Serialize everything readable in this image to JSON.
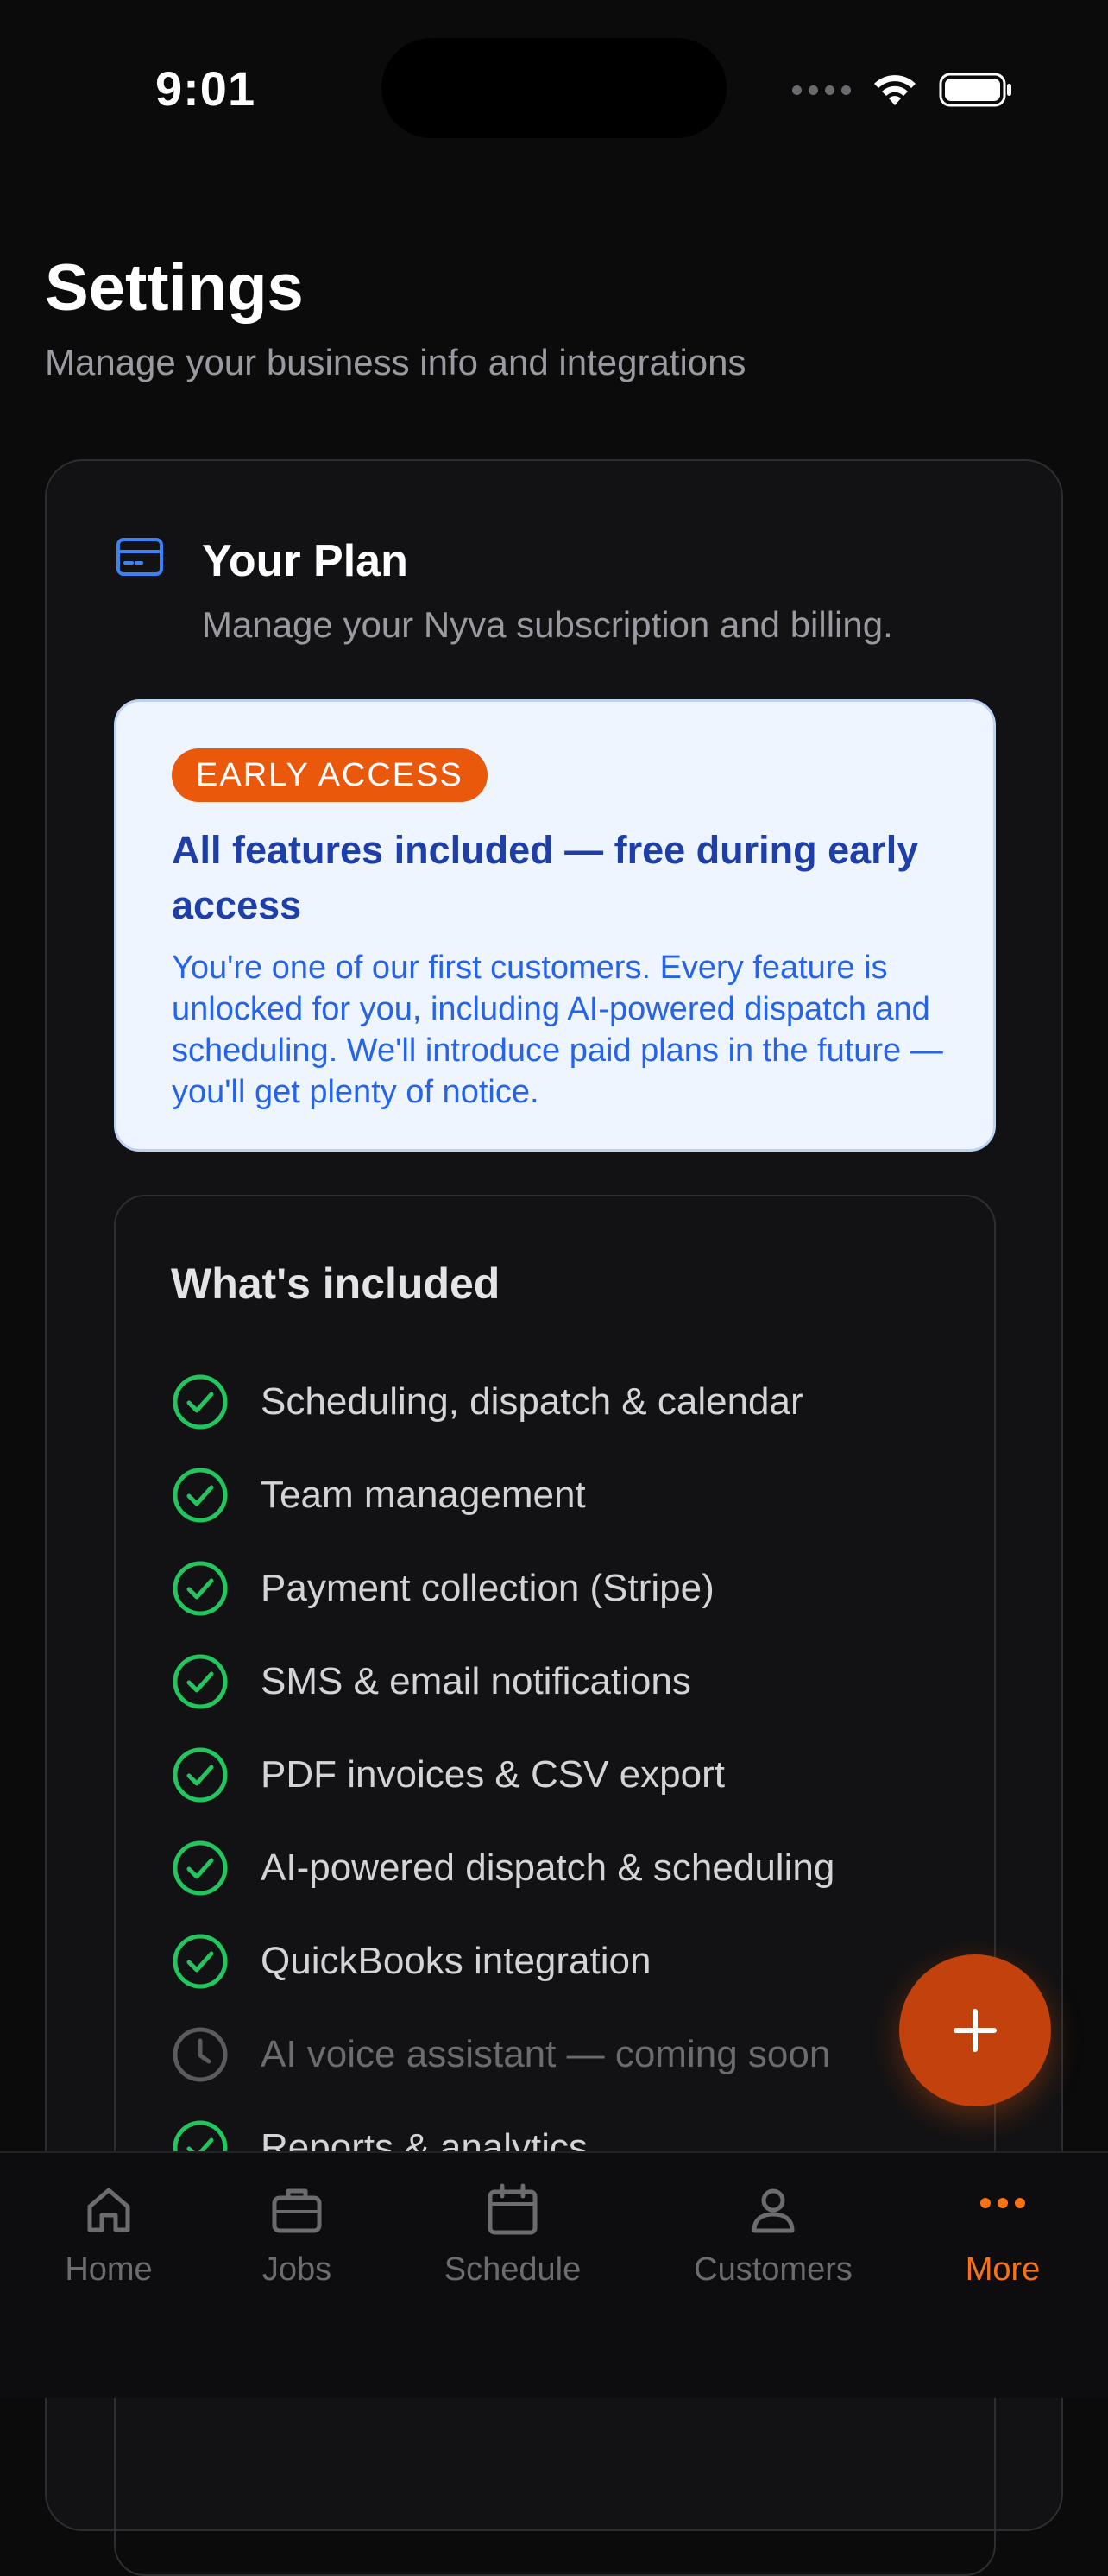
{
  "status_bar": {
    "time": "9:01"
  },
  "header": {
    "title": "Settings",
    "subtitle": "Manage your business info and integrations"
  },
  "plan": {
    "icon": "credit-card-icon",
    "title": "Your Plan",
    "description": "Manage your Nyva subscription and billing.",
    "early_access": {
      "badge": "EARLY ACCESS",
      "heading": "All features included — free during early access",
      "body": "You're one of our first customers. Every feature is unlocked for you, including AI-powered dispatch and scheduling. We'll introduce paid plans in the future — you'll get plenty of notice."
    },
    "included": {
      "title": "What's included",
      "features": [
        {
          "label": "Scheduling, dispatch & calendar",
          "status": "included"
        },
        {
          "label": "Team management",
          "status": "included"
        },
        {
          "label": "Payment collection (Stripe)",
          "status": "included"
        },
        {
          "label": "SMS & email notifications",
          "status": "included"
        },
        {
          "label": "PDF invoices & CSV export",
          "status": "included"
        },
        {
          "label": "AI-powered dispatch & scheduling",
          "status": "included"
        },
        {
          "label": "QuickBooks integration",
          "status": "included"
        },
        {
          "label": "AI voice assistant — coming soon",
          "status": "coming-soon"
        },
        {
          "label": "Reports & analytics",
          "status": "included"
        }
      ]
    }
  },
  "fab": {
    "icon": "plus-icon"
  },
  "nav": {
    "items": [
      {
        "label": "Home",
        "icon": "home-icon"
      },
      {
        "label": "Jobs",
        "icon": "briefcase-icon"
      },
      {
        "label": "Schedule",
        "icon": "calendar-icon"
      },
      {
        "label": "Customers",
        "icon": "user-icon"
      },
      {
        "label": "More",
        "icon": "more-dots-icon",
        "active": true
      }
    ]
  },
  "colors": {
    "accent": "#f97316",
    "fab": "#c2410c",
    "check": "#22c55e",
    "plan_icon": "#3b82f6",
    "badge": "#ea580c"
  }
}
